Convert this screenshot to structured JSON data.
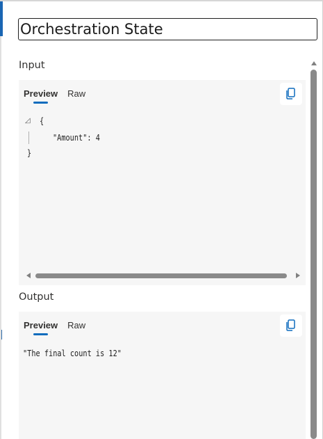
{
  "header": {
    "title": "Orchestration State"
  },
  "input": {
    "label": "Input",
    "tabs": [
      {
        "label": "Preview",
        "active": true
      },
      {
        "label": "Raw",
        "active": false
      }
    ],
    "code_lines": [
      "{",
      "\"Amount\": 4",
      "}"
    ],
    "fold_icon": "collapse-triangle-icon"
  },
  "output": {
    "label": "Output",
    "tabs": [
      {
        "label": "Preview",
        "active": true
      },
      {
        "label": "Raw",
        "active": false
      }
    ],
    "value": "\"The final count is 12\""
  },
  "icons": {
    "copy": "copy-icon"
  },
  "colors": {
    "accent": "#0f6cbd",
    "panel_bg": "#f6f6f6",
    "scrollbar": "#8a8a8a"
  }
}
